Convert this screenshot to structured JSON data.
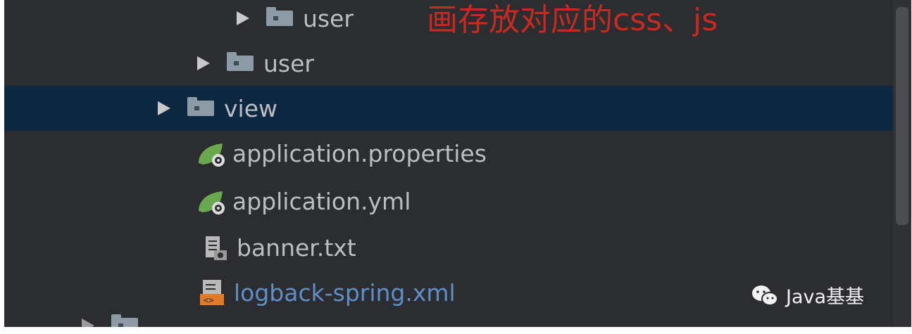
{
  "annotation": "画存放对应的css、js",
  "tree": {
    "items": [
      {
        "label": "user",
        "kind": "folder"
      },
      {
        "label": "user",
        "kind": "folder"
      },
      {
        "label": "view",
        "kind": "folder",
        "selected": true
      },
      {
        "label": "application.properties",
        "kind": "spring-config"
      },
      {
        "label": "application.yml",
        "kind": "spring-config"
      },
      {
        "label": "banner.txt",
        "kind": "text-file"
      },
      {
        "label": "logback-spring.xml",
        "kind": "xml-file"
      }
    ]
  },
  "watermark": {
    "text": "Java基基"
  },
  "colors": {
    "background": "#2b2d30",
    "selection": "#0c2941",
    "text": "#bcbec4",
    "link_text": "#5f8fc8",
    "annotation": "#c62a20"
  }
}
